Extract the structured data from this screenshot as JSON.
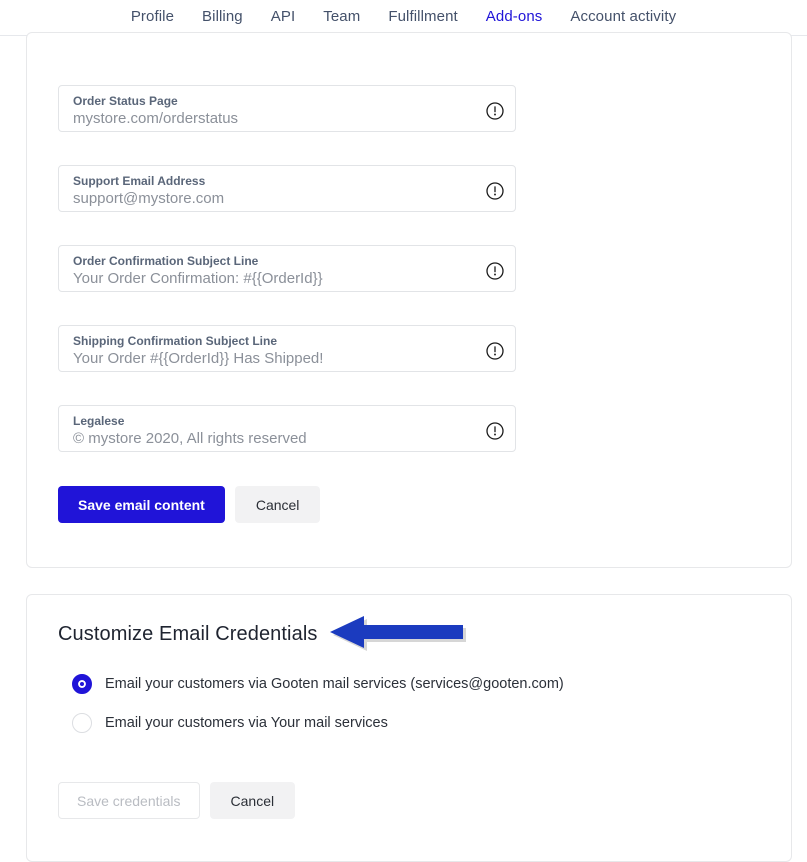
{
  "nav": {
    "items": [
      {
        "label": "Profile",
        "active": false
      },
      {
        "label": "Billing",
        "active": false
      },
      {
        "label": "API",
        "active": false
      },
      {
        "label": "Team",
        "active": false
      },
      {
        "label": "Fulfillment",
        "active": false
      },
      {
        "label": "Add-ons",
        "active": true
      },
      {
        "label": "Account activity",
        "active": false
      }
    ],
    "active_color": "#2014d8",
    "inactive_color": "#44516a"
  },
  "email_content": {
    "fields": [
      {
        "label": "Order Status Page",
        "value": "mystore.com/orderstatus",
        "icon": "info-circle-icon"
      },
      {
        "label": "Support Email Address",
        "value": "support@mystore.com",
        "icon": "info-circle-icon"
      },
      {
        "label": "Order Confirmation Subject Line",
        "value": "Your Order Confirmation: #{{OrderId}}",
        "icon": "info-circle-icon"
      },
      {
        "label": "Shipping Confirmation Subject Line",
        "value": "Your Order #{{OrderId}} Has Shipped!",
        "icon": "info-circle-icon"
      },
      {
        "label": "Legalese",
        "value": "© mystore 2020, All rights reserved",
        "icon": "info-circle-icon"
      }
    ],
    "save_label": "Save email content",
    "cancel_label": "Cancel"
  },
  "email_credentials": {
    "title": "Customize Email Credentials",
    "options": [
      {
        "label": "Email your customers via Gooten mail services (services@gooten.com)",
        "selected": true
      },
      {
        "label": "Email your customers via Your mail services",
        "selected": false
      }
    ],
    "save_label": "Save credentials",
    "save_disabled": true,
    "cancel_label": "Cancel"
  },
  "annotation": {
    "arrow": "left-arrow-annotation",
    "color": "#1b3bbf"
  }
}
